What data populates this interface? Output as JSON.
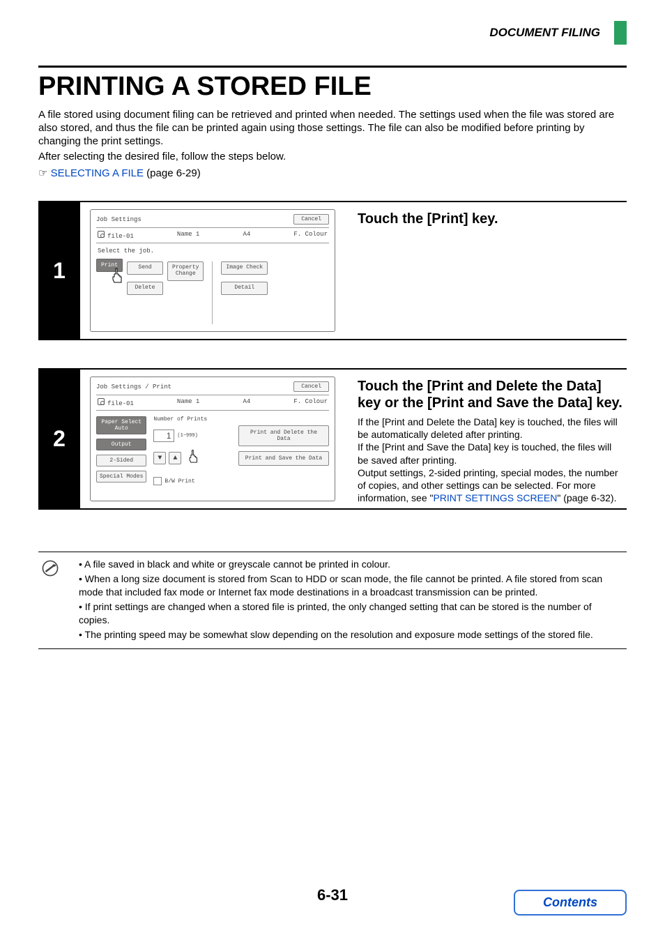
{
  "header": {
    "section": "DOCUMENT FILING"
  },
  "title": "PRINTING A STORED FILE",
  "intro": "A file stored using document filing can be retrieved and printed when needed. The settings used when the file was stored are also stored, and thus the file can be printed again using those settings. The file can also be modified before printing by changing the print settings.",
  "after_select": "After selecting the desired file, follow the steps below.",
  "link": {
    "glyph": "☞",
    "text": "SELECTING A FILE",
    "page": " (page 6-29)"
  },
  "steps": [
    {
      "num": "1",
      "heading": "Touch the [Print] key.",
      "panel": {
        "title": "Job Settings",
        "cancel": "Cancel",
        "file": {
          "name": "file-01",
          "user": "Name 1",
          "size": "A4",
          "color": "F. Colour"
        },
        "subtext": "Select the job.",
        "buttons": {
          "print": "Print",
          "send": "Send",
          "delete": "Delete",
          "property": "Property\nChange",
          "image_check": "Image Check",
          "detail": "Detail"
        }
      }
    },
    {
      "num": "2",
      "heading": "Touch the [Print and Delete the Data] key or the [Print and Save the Data] key.",
      "body_lines": [
        "If the [Print and Delete the Data] key is touched, the files will be automatically deleted after printing.",
        "If the [Print and Save the Data] key is touched, the files will be saved after printing.",
        "Output settings, 2-sided printing, special modes, the number of copies, and other settings can be selected. For more information, see \""
      ],
      "link_text": "PRINT SETTINGS SCREEN",
      "link_suffix": "\" (page 6-32).",
      "panel": {
        "title": "Job Settings / Print",
        "cancel": "Cancel",
        "file": {
          "name": "file-01",
          "user": "Name 1",
          "size": "A4",
          "color": "F. Colour"
        },
        "left": {
          "paper_select": "Paper Select",
          "auto": "Auto",
          "output": "Output",
          "two_sided": "2-Sided",
          "special": "Special Modes"
        },
        "copies": {
          "label": "Number of Prints",
          "value": "1",
          "range": "(1~999)"
        },
        "actions": {
          "print_delete": "Print and Delete the Data",
          "print_save": "Print and Save the Data"
        },
        "bw": "B/W Print"
      }
    }
  ],
  "notes": [
    "A file saved in black and white or greyscale cannot be printed in colour.",
    "When a long size document is stored from Scan to HDD or scan mode, the file cannot be printed. A file stored from scan mode that included fax mode or Internet fax mode destinations in a broadcast transmission can be printed.",
    "If print settings are changed when a stored file is printed, the only changed setting that can be stored is the number of copies.",
    "The printing speed may be somewhat slow depending on the resolution and exposure mode settings of the stored file."
  ],
  "page_num": "6-31",
  "contents": "Contents"
}
